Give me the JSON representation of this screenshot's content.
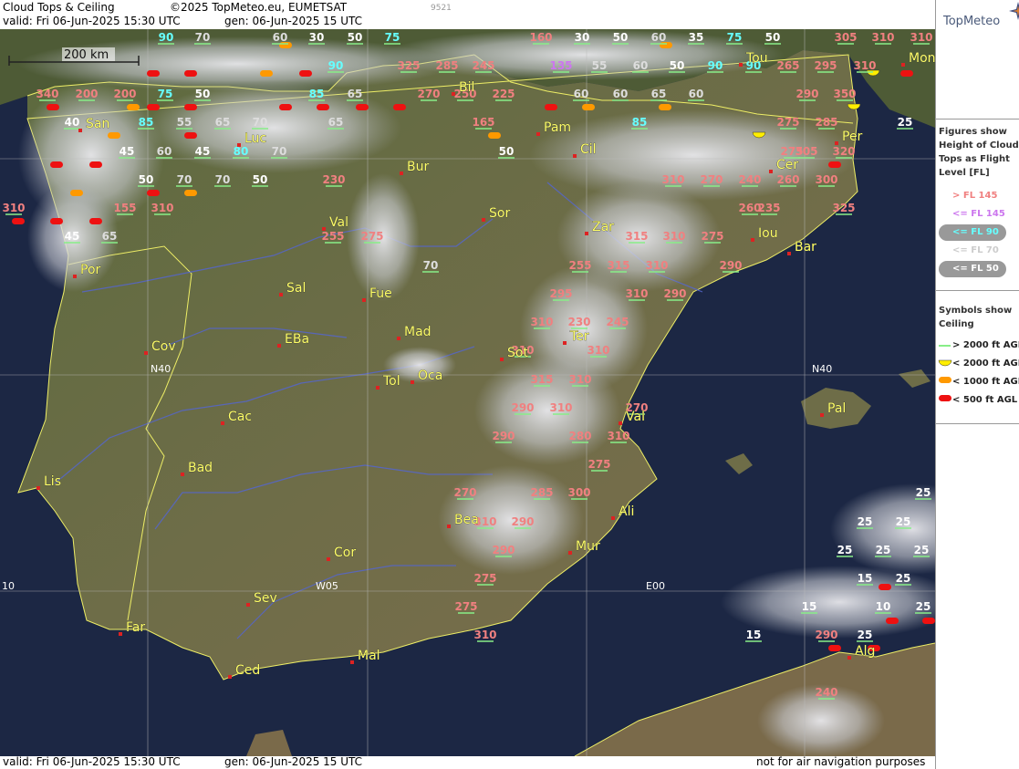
{
  "header": {
    "title": "Cloud Tops & Ceiling",
    "copyright": "©2025 TopMeteo.eu, EUMETSAT",
    "valid": "valid:  Fri  06-Jun-2025  15:30 UTC",
    "gen": "gen: 06-Jun-2025 15 UTC",
    "small_id": "9521"
  },
  "footer": {
    "valid": "valid:  Fri  06-Jun-2025  15:30 UTC",
    "gen": "gen: 06-Jun-2025 15 UTC",
    "disclaimer": "not for air navigation purposes"
  },
  "logo": "TopMeteo",
  "scale_label": "200 km",
  "grid_labels": {
    "lat": "N40",
    "lat2": "N40",
    "lon1": "W05",
    "lon2": "E00",
    "lon3": "10"
  },
  "legend": {
    "figures_title": [
      "Figures show",
      "Height of Cloud",
      "Tops as Flight",
      "Level  [FL]"
    ],
    "fl_items": [
      {
        "label": "> FL 145",
        "color": "#f08080"
      },
      {
        "label": "<= FL 145",
        "color": "#cc77ee"
      },
      {
        "label": "<= FL 90",
        "color": "#66ffff"
      },
      {
        "label": "<= FL 70",
        "color": "#dddddd"
      },
      {
        "label": "<= FL 50",
        "color": "#ffffff"
      }
    ],
    "symbols_title": [
      "Symbols show",
      "Ceiling"
    ],
    "ceil_items": [
      {
        "label": "> 2000 ft AGL",
        "color": "#88ee88"
      },
      {
        "label": "< 2000 ft AGL",
        "color": "#ffee00"
      },
      {
        "label": "< 1000 ft AGL",
        "color": "#ff9900"
      },
      {
        "label": "< 500 ft AGL",
        "color": "#ee1111"
      }
    ]
  },
  "cities": [
    {
      "name": "Bil"
    },
    {
      "name": "San"
    },
    {
      "name": "Luc"
    },
    {
      "name": "Pam"
    },
    {
      "name": "Cil"
    },
    {
      "name": "Tou"
    },
    {
      "name": "Mon"
    },
    {
      "name": "Per"
    },
    {
      "name": "Cer"
    },
    {
      "name": "Bur"
    },
    {
      "name": "Val"
    },
    {
      "name": "Sor"
    },
    {
      "name": "Zar"
    },
    {
      "name": "Iou"
    },
    {
      "name": "Bar"
    },
    {
      "name": "Por"
    },
    {
      "name": "Sal"
    },
    {
      "name": "Fue"
    },
    {
      "name": "Mad"
    },
    {
      "name": "EBa"
    },
    {
      "name": "Cov"
    },
    {
      "name": "Tol"
    },
    {
      "name": "Oca"
    },
    {
      "name": "Sot"
    },
    {
      "name": "Ter"
    },
    {
      "name": "Cac"
    },
    {
      "name": "Val"
    },
    {
      "name": "Pal"
    },
    {
      "name": "Lis"
    },
    {
      "name": "Bad"
    },
    {
      "name": "Bea"
    },
    {
      "name": "Ali"
    },
    {
      "name": "Mur"
    },
    {
      "name": "Cor"
    },
    {
      "name": "Sev"
    },
    {
      "name": "Far"
    },
    {
      "name": "Ced"
    },
    {
      "name": "Mal"
    },
    {
      "name": "Alg"
    }
  ],
  "cloud_top_figures": [
    {
      "v": "90",
      "c": "cyan"
    },
    {
      "v": "70",
      "c": "grey"
    },
    {
      "v": "60",
      "c": "grey"
    },
    {
      "v": "30",
      "c": "white"
    },
    {
      "v": "50",
      "c": "white"
    },
    {
      "v": "75",
      "c": "cyan"
    },
    {
      "v": "160",
      "c": "pink"
    },
    {
      "v": "30",
      "c": "white"
    },
    {
      "v": "50",
      "c": "white"
    },
    {
      "v": "60",
      "c": "grey"
    },
    {
      "v": "35",
      "c": "white"
    },
    {
      "v": "75",
      "c": "cyan"
    },
    {
      "v": "50",
      "c": "white"
    },
    {
      "v": "305",
      "c": "pink"
    },
    {
      "v": "310",
      "c": "pink"
    },
    {
      "v": "310",
      "c": "pink"
    },
    {
      "v": "90",
      "c": "cyan"
    },
    {
      "v": "325",
      "c": "pink"
    },
    {
      "v": "285",
      "c": "pink"
    },
    {
      "v": "245",
      "c": "pink"
    },
    {
      "v": "135",
      "c": "violet"
    },
    {
      "v": "55",
      "c": "grey"
    },
    {
      "v": "60",
      "c": "grey"
    },
    {
      "v": "50",
      "c": "white"
    },
    {
      "v": "90",
      "c": "cyan"
    },
    {
      "v": "90",
      "c": "cyan"
    },
    {
      "v": "265",
      "c": "pink"
    },
    {
      "v": "295",
      "c": "pink"
    },
    {
      "v": "310",
      "c": "pink"
    },
    {
      "v": "340",
      "c": "pink"
    },
    {
      "v": "200",
      "c": "pink"
    },
    {
      "v": "200",
      "c": "pink"
    },
    {
      "v": "75",
      "c": "cyan"
    },
    {
      "v": "50",
      "c": "white"
    },
    {
      "v": "85",
      "c": "cyan"
    },
    {
      "v": "65",
      "c": "grey"
    },
    {
      "v": "270",
      "c": "pink"
    },
    {
      "v": "250",
      "c": "pink"
    },
    {
      "v": "225",
      "c": "pink"
    },
    {
      "v": "60",
      "c": "grey"
    },
    {
      "v": "60",
      "c": "grey"
    },
    {
      "v": "65",
      "c": "grey"
    },
    {
      "v": "60",
      "c": "grey"
    },
    {
      "v": "290",
      "c": "pink"
    },
    {
      "v": "350",
      "c": "pink"
    },
    {
      "v": "40",
      "c": "white"
    },
    {
      "v": "85",
      "c": "cyan"
    },
    {
      "v": "55",
      "c": "grey"
    },
    {
      "v": "65",
      "c": "grey"
    },
    {
      "v": "70",
      "c": "grey"
    },
    {
      "v": "65",
      "c": "grey"
    },
    {
      "v": "165",
      "c": "pink"
    },
    {
      "v": "85",
      "c": "cyan"
    },
    {
      "v": "275",
      "c": "pink"
    },
    {
      "v": "285",
      "c": "pink"
    },
    {
      "v": "25",
      "c": "white"
    },
    {
      "v": "45",
      "c": "white"
    },
    {
      "v": "60",
      "c": "grey"
    },
    {
      "v": "45",
      "c": "white"
    },
    {
      "v": "80",
      "c": "cyan"
    },
    {
      "v": "70",
      "c": "grey"
    },
    {
      "v": "50",
      "c": "white"
    },
    {
      "v": "275",
      "c": "pink"
    },
    {
      "v": "305",
      "c": "pink"
    },
    {
      "v": "320",
      "c": "pink"
    },
    {
      "v": "50",
      "c": "white"
    },
    {
      "v": "70",
      "c": "grey"
    },
    {
      "v": "70",
      "c": "grey"
    },
    {
      "v": "50",
      "c": "white"
    },
    {
      "v": "230",
      "c": "pink"
    },
    {
      "v": "310",
      "c": "pink"
    },
    {
      "v": "270",
      "c": "pink"
    },
    {
      "v": "240",
      "c": "pink"
    },
    {
      "v": "260",
      "c": "pink"
    },
    {
      "v": "300",
      "c": "pink"
    },
    {
      "v": "310",
      "c": "pink"
    },
    {
      "v": "155",
      "c": "pink"
    },
    {
      "v": "310",
      "c": "pink"
    },
    {
      "v": "260",
      "c": "pink"
    },
    {
      "v": "235",
      "c": "pink"
    },
    {
      "v": "325",
      "c": "pink"
    },
    {
      "v": "45",
      "c": "white"
    },
    {
      "v": "65",
      "c": "grey"
    },
    {
      "v": "255",
      "c": "pink"
    },
    {
      "v": "275",
      "c": "pink"
    },
    {
      "v": "315",
      "c": "pink"
    },
    {
      "v": "310",
      "c": "pink"
    },
    {
      "v": "275",
      "c": "pink"
    },
    {
      "v": "70",
      "c": "grey"
    },
    {
      "v": "255",
      "c": "pink"
    },
    {
      "v": "315",
      "c": "pink"
    },
    {
      "v": "310",
      "c": "pink"
    },
    {
      "v": "290",
      "c": "pink"
    },
    {
      "v": "295",
      "c": "pink"
    },
    {
      "v": "310",
      "c": "pink"
    },
    {
      "v": "290",
      "c": "pink"
    },
    {
      "v": "310",
      "c": "pink"
    },
    {
      "v": "230",
      "c": "pink"
    },
    {
      "v": "245",
      "c": "pink"
    },
    {
      "v": "310",
      "c": "pink"
    },
    {
      "v": "310",
      "c": "pink"
    },
    {
      "v": "315",
      "c": "pink"
    },
    {
      "v": "310",
      "c": "pink"
    },
    {
      "v": "290",
      "c": "pink"
    },
    {
      "v": "310",
      "c": "pink"
    },
    {
      "v": "270",
      "c": "pink"
    },
    {
      "v": "280",
      "c": "pink"
    },
    {
      "v": "310",
      "c": "pink"
    },
    {
      "v": "290",
      "c": "pink"
    },
    {
      "v": "275",
      "c": "pink"
    },
    {
      "v": "270",
      "c": "pink"
    },
    {
      "v": "285",
      "c": "pink"
    },
    {
      "v": "300",
      "c": "pink"
    },
    {
      "v": "310",
      "c": "pink"
    },
    {
      "v": "290",
      "c": "pink"
    },
    {
      "v": "290",
      "c": "pink"
    },
    {
      "v": "275",
      "c": "pink"
    },
    {
      "v": "275",
      "c": "pink"
    },
    {
      "v": "310",
      "c": "pink"
    },
    {
      "v": "25",
      "c": "white"
    },
    {
      "v": "25",
      "c": "white"
    },
    {
      "v": "25",
      "c": "white"
    },
    {
      "v": "25",
      "c": "white"
    },
    {
      "v": "25",
      "c": "white"
    },
    {
      "v": "25",
      "c": "white"
    },
    {
      "v": "15",
      "c": "white"
    },
    {
      "v": "25",
      "c": "white"
    },
    {
      "v": "15",
      "c": "white"
    },
    {
      "v": "10",
      "c": "white"
    },
    {
      "v": "25",
      "c": "white"
    },
    {
      "v": "15",
      "c": "white"
    },
    {
      "v": "25",
      "c": "white"
    },
    {
      "v": "290",
      "c": "pink"
    },
    {
      "v": "240",
      "c": "pink"
    }
  ]
}
